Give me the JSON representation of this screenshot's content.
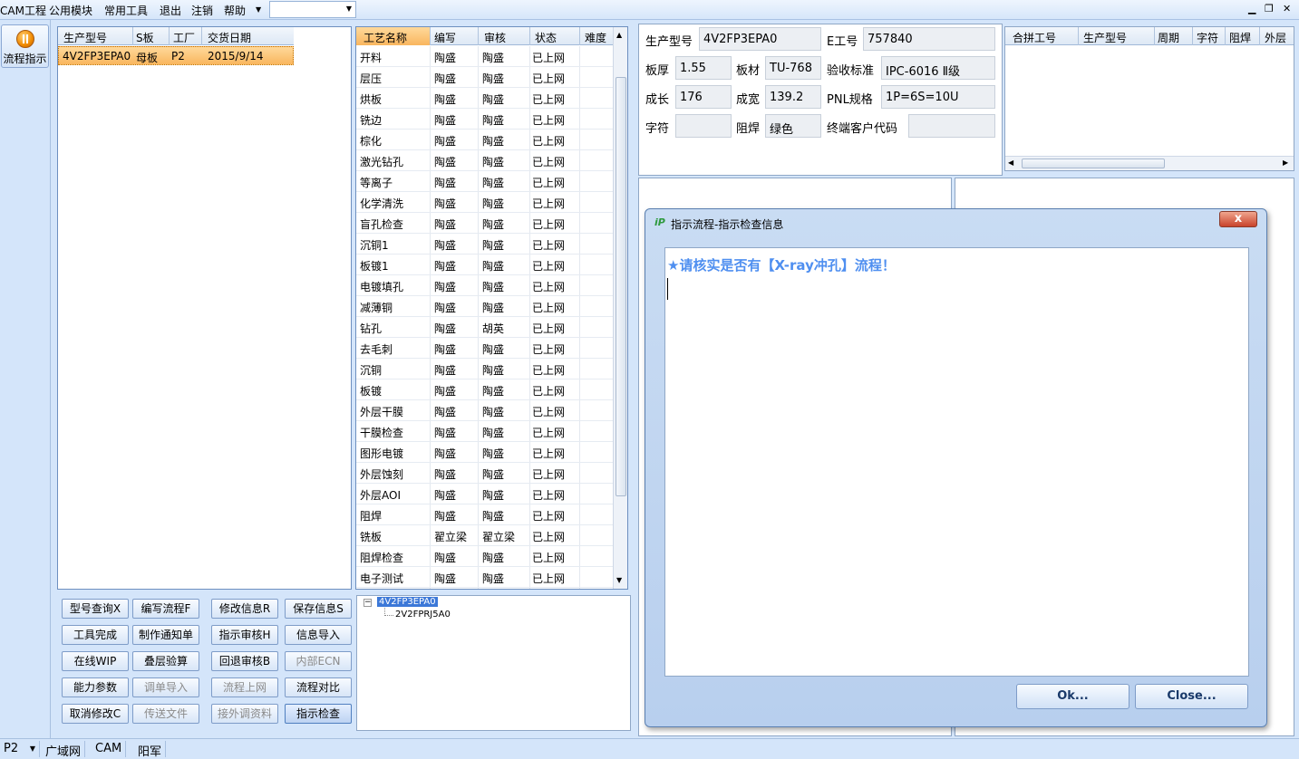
{
  "menu": {
    "items": [
      "CAM工程",
      "公用模块",
      "常用工具",
      "退出",
      "注销",
      "帮助"
    ]
  },
  "window_controls": [
    "minimize",
    "restore",
    "close"
  ],
  "left_nav": {
    "label": "流程指示",
    "icon": "pause-icon"
  },
  "order_table": {
    "headers": [
      "生产型号",
      "S板",
      "工厂",
      "交货日期"
    ],
    "rows": [
      [
        "4V2FP3EPA0",
        "母板",
        "P2",
        "2015/9/14"
      ]
    ]
  },
  "process_table": {
    "headers": [
      "工艺名称",
      "编写",
      "审核",
      "状态",
      "难度"
    ],
    "rows": [
      [
        "开料",
        "陶盛",
        "陶盛",
        "已上网"
      ],
      [
        "层压",
        "陶盛",
        "陶盛",
        "已上网"
      ],
      [
        "烘板",
        "陶盛",
        "陶盛",
        "已上网"
      ],
      [
        "铣边",
        "陶盛",
        "陶盛",
        "已上网"
      ],
      [
        "棕化",
        "陶盛",
        "陶盛",
        "已上网"
      ],
      [
        "激光钻孔",
        "陶盛",
        "陶盛",
        "已上网"
      ],
      [
        "等离子",
        "陶盛",
        "陶盛",
        "已上网"
      ],
      [
        "化学清洗",
        "陶盛",
        "陶盛",
        "已上网"
      ],
      [
        "盲孔检查",
        "陶盛",
        "陶盛",
        "已上网"
      ],
      [
        "沉铜1",
        "陶盛",
        "陶盛",
        "已上网"
      ],
      [
        "板镀1",
        "陶盛",
        "陶盛",
        "已上网"
      ],
      [
        "电镀填孔",
        "陶盛",
        "陶盛",
        "已上网"
      ],
      [
        "减薄铜",
        "陶盛",
        "陶盛",
        "已上网"
      ],
      [
        "钻孔",
        "陶盛",
        "胡英",
        "已上网"
      ],
      [
        "去毛刺",
        "陶盛",
        "陶盛",
        "已上网"
      ],
      [
        "沉铜",
        "陶盛",
        "陶盛",
        "已上网"
      ],
      [
        "板镀",
        "陶盛",
        "陶盛",
        "已上网"
      ],
      [
        "外层干膜",
        "陶盛",
        "陶盛",
        "已上网"
      ],
      [
        "干膜检查",
        "陶盛",
        "陶盛",
        "已上网"
      ],
      [
        "图形电镀",
        "陶盛",
        "陶盛",
        "已上网"
      ],
      [
        "外层蚀刻",
        "陶盛",
        "陶盛",
        "已上网"
      ],
      [
        "外层AOI",
        "陶盛",
        "陶盛",
        "已上网"
      ],
      [
        "阻焊",
        "陶盛",
        "陶盛",
        "已上网"
      ],
      [
        "铣板",
        "翟立梁",
        "翟立梁",
        "已上网"
      ],
      [
        "阻焊检查",
        "陶盛",
        "陶盛",
        "已上网"
      ],
      [
        "电子测试",
        "陶盛",
        "陶盛",
        "已上网"
      ]
    ]
  },
  "buttons": [
    [
      "型号查询X",
      "编写流程F",
      "修改信息R",
      "保存信息S"
    ],
    [
      "工具完成",
      "制作通知单",
      "指示审核H",
      "信息导入"
    ],
    [
      "在线WIP",
      "叠层验算",
      "回退审核B",
      "内部ECN"
    ],
    [
      "能力参数",
      "调单导入",
      "流程上网",
      "流程对比"
    ],
    [
      "取消修改C",
      "传送文件",
      "接外调资料",
      "指示检查"
    ]
  ],
  "tree": {
    "root": "4V2FP3EPA0",
    "child": "2V2FPRJ5A0"
  },
  "info": {
    "model_label": "生产型号",
    "model": "4V2FP3EPA0",
    "eno_label": "E工号",
    "eno": "757840",
    "thick_label": "板厚",
    "thick": "1.55",
    "mat_label": "板材",
    "mat": "TU-768",
    "std_label": "验收标准",
    "std": "IPC-6016 Ⅱ级",
    "len_label": "成长",
    "len": "176",
    "wid_label": "成宽",
    "wid": "139.2",
    "pnl_label": "PNL规格",
    "pnl": "1P=6S=10U",
    "char_label": "字符",
    "char": "",
    "mask_label": "阻焊",
    "mask": "绿色",
    "cust_label": "终端客户代码",
    "cust": ""
  },
  "merge_table": {
    "headers": [
      "合拼工号",
      "生产型号",
      "周期",
      "字符",
      "阻焊",
      "外层"
    ]
  },
  "dialog": {
    "title": "指示流程-指示检查信息",
    "close": "x",
    "message": "★请核实是否有【X-ray冲孔】流程！",
    "ok": "Ok...",
    "close_btn": "Close..."
  },
  "status": {
    "plant": "P2",
    "items": [
      "广域网",
      "CAM",
      "阳军"
    ]
  }
}
